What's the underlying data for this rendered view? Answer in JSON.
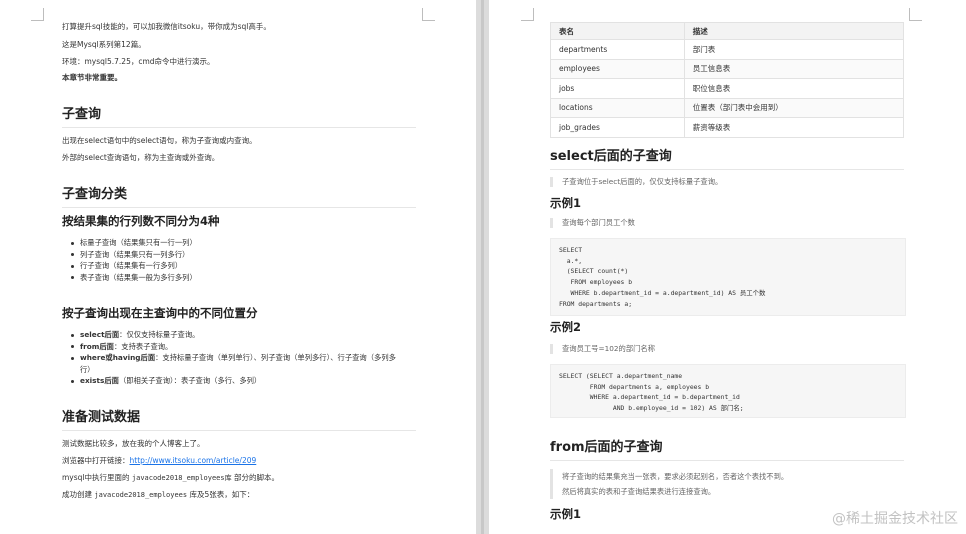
{
  "left": {
    "intro1": "打算提升sql技能的，可以加我微信itsoku，带你成为sql高手。",
    "intro2": "这是Mysql系列第12篇。",
    "intro3": "环境：mysql5.7.25，cmd命令中进行演示。",
    "intro4": "本章节非常重要。",
    "h_subquery": "子查询",
    "sub_p1": "出现在select语句中的select语句，称为子查询或内查询。",
    "sub_p2": "外部的select查询语句，称为主查询或外查询。",
    "h_category": "子查询分类",
    "h_by_rows": "按结果集的行列数不同分为4种",
    "rows_items": [
      "标量子查询（结果集只有一行一列）",
      "列子查询（结果集只有一列多行）",
      "行子查询（结果集有一行多列）",
      "表子查询（结果集一般为多行多列）"
    ],
    "h_by_position": "按子查询出现在主查询中的不同位置分",
    "pos1_b": "select后面",
    "pos1_t": "：仅仅支持标量子查询。",
    "pos2_b": "from后面",
    "pos2_t": "：支持表子查询。",
    "pos3_b": "where或having后面",
    "pos3_t": "：支持标量子查询（单列单行）、列子查询（单列多行）、行子查询（多列多行）",
    "pos4_b": "exists后面",
    "pos4_t": "（即相关子查询）：表子查询（多行、多列）",
    "h_prepare": "准备测试数据",
    "prep_p1": "测试数据比较多，放在我的个人博客上了。",
    "prep_p2_pre": "浏览器中打开链接：",
    "prep_link": "http://www.itsoku.com/article/209",
    "prep_p3_a": "mysql中执行里面的 ",
    "prep_p3_code": "javacode2018_employees库",
    "prep_p3_b": " 部分的脚本。",
    "prep_p4_a": "成功创建 ",
    "prep_p4_code": "javacode2018_employees",
    "prep_p4_b": " 库及5张表，如下："
  },
  "right": {
    "table_headers": [
      "表名",
      "描述"
    ],
    "table_rows": [
      [
        "departments",
        "部门表"
      ],
      [
        "employees",
        "员工信息表"
      ],
      [
        "jobs",
        "职位信息表"
      ],
      [
        "locations",
        "位置表（部门表中会用到）"
      ],
      [
        "job_grades",
        "薪资等级表"
      ]
    ],
    "h_select_sub": "select后面的子查询",
    "q_select": "子查询位于select后面的，仅仅支持标量子查询。",
    "h_ex1": "示例1",
    "q_ex1": "查询每个部门员工个数",
    "code1": "SELECT\n  a.*,\n  (SELECT count(*)\n   FROM employees b\n   WHERE b.department_id = a.department_id) AS 员工个数\nFROM departments a;",
    "h_ex2": "示例2",
    "q_ex2": "查询员工号=102的部门名称",
    "code2": "SELECT (SELECT a.department_name\n        FROM departments a, employees b\n        WHERE a.department_id = b.department_id\n              AND b.employee_id = 102) AS 部门名;",
    "h_from_sub": "from后面的子查询",
    "q_from1": "将子查询的结果集充当一张表，要求必须起别名，否者这个表找不到。",
    "q_from2": "然后将真实的表和子查询结果表进行连接查询。",
    "h_ex1b": "示例1"
  },
  "watermark": "@稀土掘金技术社区"
}
